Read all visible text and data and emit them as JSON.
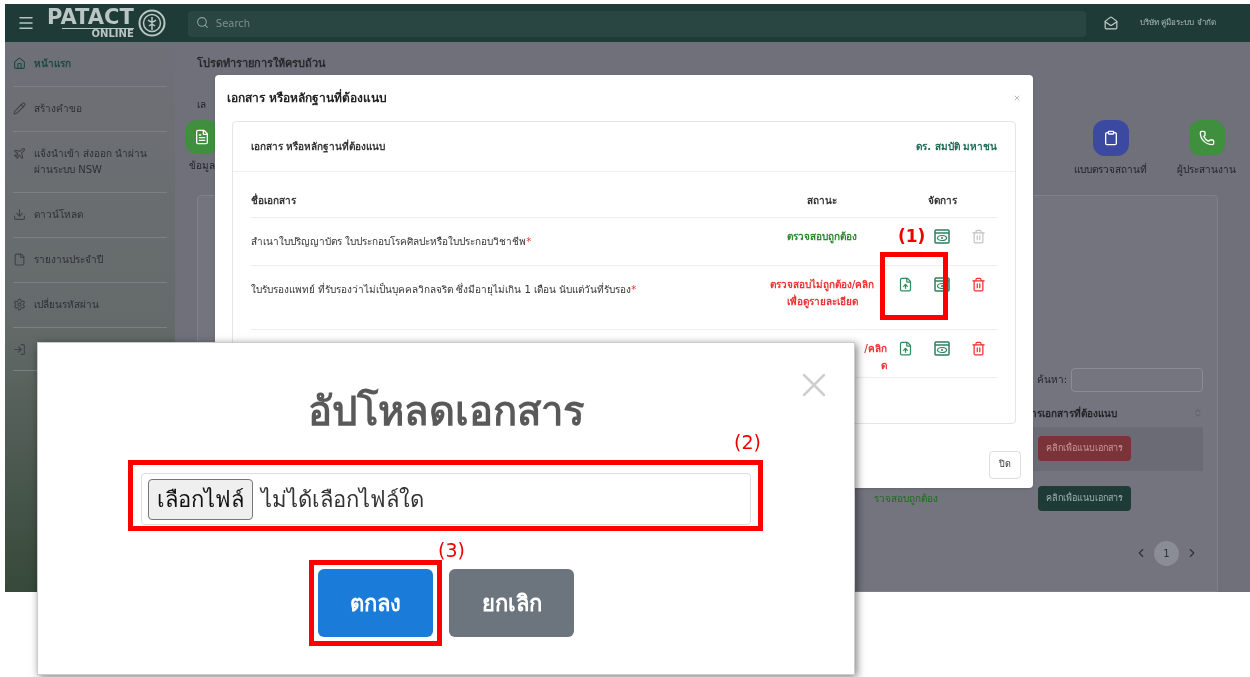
{
  "header": {
    "logo_text": "PATACT",
    "logo_subtext": "ONLINE",
    "search": {
      "placeholder": "Search"
    },
    "company": "บริษัท คู่มือระบบ จำกัด"
  },
  "sidebar": {
    "items": [
      {
        "kind": "home",
        "label": "หน้าแรก",
        "selected": true
      },
      {
        "kind": "pencil",
        "label": "สร้างคำขอ",
        "selected": false
      },
      {
        "kind": "plane",
        "label": "แจ้งนำเข้า ส่งออก นำผ่าน ผ่านระบบ NSW",
        "selected": false
      },
      {
        "kind": "download",
        "label": "ดาวน์โหลด",
        "selected": false
      },
      {
        "kind": "file",
        "label": "รายงานประจำปี",
        "selected": false
      },
      {
        "kind": "cogs",
        "label": "เปลี่ยนรหัสผ่าน",
        "selected": false
      },
      {
        "kind": "logout",
        "selected": false
      }
    ]
  },
  "page": {
    "title": "โปรดทำรายการให้ครบถ้วน",
    "field_label": "เล",
    "steps": [
      {
        "kind": "doc",
        "label": "ข้อมูล",
        "color": "#3f8f3f"
      },
      {
        "kind": "clipboard",
        "label": "แบบตรวจสถานที่",
        "color": "#3b4aa0"
      },
      {
        "kind": "phone",
        "label": "ผู้ประสานงาน",
        "color": "#3f8f3f"
      }
    ],
    "search_label": "ค้นหา:",
    "column_header": "ารเอกสารที่ต้องแนบ",
    "rows": [
      {
        "kind": "missing",
        "button": "คลิกเพื่อแนบเอกสาร"
      },
      {
        "kind": "verified",
        "status": "รวจสอบถูกต้อง",
        "button": "คลิกเพื่อแนบเอกสาร"
      }
    ],
    "pagination": [
      {
        "label": "1",
        "selected": true
      }
    ]
  },
  "modal": {
    "title": "เอกสาร หรือหลักฐานที่ต้องแนบ",
    "card_title": "เอกสาร หรือหลักฐานที่ต้องแนบ",
    "person": "ดร. สมบัติ มหาชน",
    "columns": [
      "ชื่อเอกสาร",
      "สถานะ",
      "จัดการ"
    ],
    "documents": [
      {
        "name": "สำเนาใบปริญญาบัตร ใบประกอบโรคศิลปะหรือใบประกอบวิชาชีพ",
        "required_mark": "*",
        "kind": "ok",
        "status": [
          "ตรวจสอบถูกต้อง"
        ],
        "delete_disabled": true
      },
      {
        "name": "ใบรับรองแพทย์ ที่รับรองว่าไม่เป็นบุคคลวิกลจริต ซึ่งมีอายุไม่เกิน 1 เดือน นับแต่วันที่รับรอง",
        "required_mark": "*",
        "kind": "error",
        "status": [
          "ตรวจสอบไม่ถูกต้อง/คลิก",
          "เพื่อดูรายละเอียด"
        ],
        "delete_disabled": false
      },
      {
        "kind": "error",
        "status": [
          "/คลิก",
          "ด"
        ],
        "delete_disabled": false
      }
    ],
    "close_button": "ปิด"
  },
  "upload_dialog": {
    "title": "อัปโหลดเอกสาร",
    "file_button": "เลือกไฟล์",
    "file_status": "ไม่ได้เลือกไฟล์ใด",
    "buttons": [
      {
        "kind": "primary",
        "label": "ตกลง"
      },
      {
        "kind": "secondary",
        "label": "ยกเลิก"
      }
    ]
  },
  "annotations": [
    "(1)",
    "(2)",
    "(3)"
  ]
}
